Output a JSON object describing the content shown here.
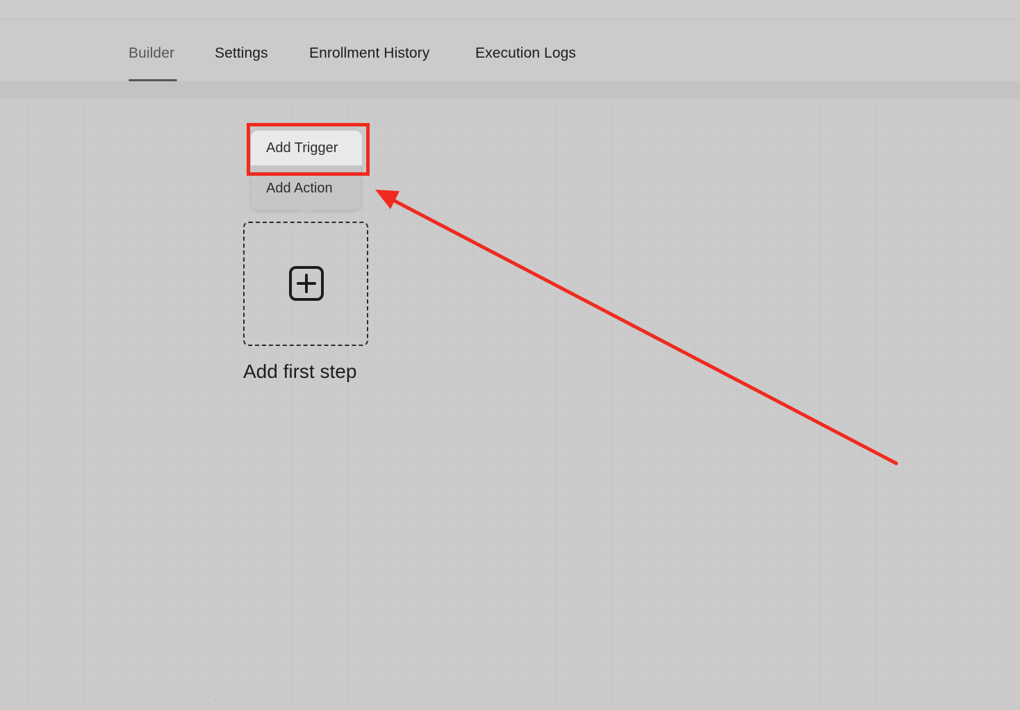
{
  "tabs": [
    {
      "label": "Builder",
      "active": true
    },
    {
      "label": "Settings",
      "active": false
    },
    {
      "label": "Enrollment History",
      "active": false
    },
    {
      "label": "Execution Logs",
      "active": false
    }
  ],
  "menu": {
    "items": [
      {
        "label": "Add Trigger"
      },
      {
        "label": "Add Action"
      }
    ]
  },
  "add_step": {
    "label": "Add first step",
    "icon": "plus-square-icon"
  },
  "annotation": {
    "highlight_color": "#f02a1e",
    "arrow_color": "#f02a1e"
  },
  "colors": {
    "background": "#cbcbcb",
    "active_tab": "#555555",
    "text": "#1c1c1c"
  }
}
